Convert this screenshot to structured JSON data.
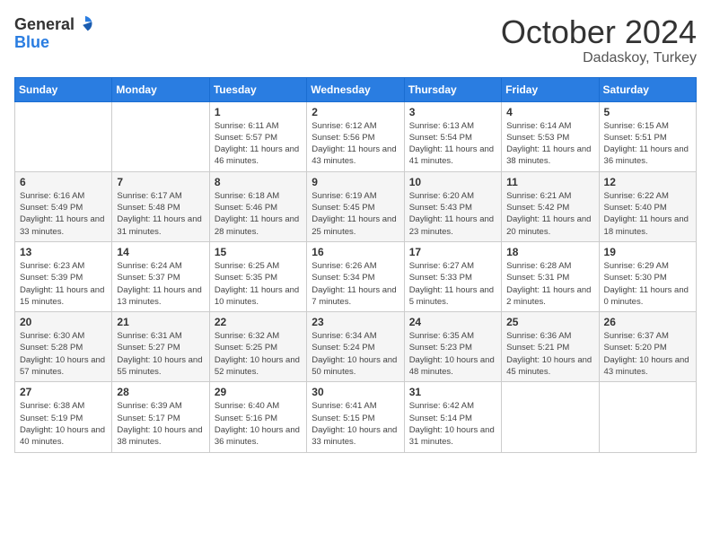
{
  "header": {
    "logo": {
      "general": "General",
      "blue": "Blue"
    },
    "month": "October 2024",
    "location": "Dadaskoy, Turkey"
  },
  "days_of_week": [
    "Sunday",
    "Monday",
    "Tuesday",
    "Wednesday",
    "Thursday",
    "Friday",
    "Saturday"
  ],
  "weeks": [
    [
      {
        "day": null,
        "info": null
      },
      {
        "day": null,
        "info": null
      },
      {
        "day": "1",
        "sunrise": "6:11 AM",
        "sunset": "5:57 PM",
        "daylight": "11 hours and 46 minutes."
      },
      {
        "day": "2",
        "sunrise": "6:12 AM",
        "sunset": "5:56 PM",
        "daylight": "11 hours and 43 minutes."
      },
      {
        "day": "3",
        "sunrise": "6:13 AM",
        "sunset": "5:54 PM",
        "daylight": "11 hours and 41 minutes."
      },
      {
        "day": "4",
        "sunrise": "6:14 AM",
        "sunset": "5:53 PM",
        "daylight": "11 hours and 38 minutes."
      },
      {
        "day": "5",
        "sunrise": "6:15 AM",
        "sunset": "5:51 PM",
        "daylight": "11 hours and 36 minutes."
      }
    ],
    [
      {
        "day": "6",
        "sunrise": "6:16 AM",
        "sunset": "5:49 PM",
        "daylight": "11 hours and 33 minutes."
      },
      {
        "day": "7",
        "sunrise": "6:17 AM",
        "sunset": "5:48 PM",
        "daylight": "11 hours and 31 minutes."
      },
      {
        "day": "8",
        "sunrise": "6:18 AM",
        "sunset": "5:46 PM",
        "daylight": "11 hours and 28 minutes."
      },
      {
        "day": "9",
        "sunrise": "6:19 AM",
        "sunset": "5:45 PM",
        "daylight": "11 hours and 25 minutes."
      },
      {
        "day": "10",
        "sunrise": "6:20 AM",
        "sunset": "5:43 PM",
        "daylight": "11 hours and 23 minutes."
      },
      {
        "day": "11",
        "sunrise": "6:21 AM",
        "sunset": "5:42 PM",
        "daylight": "11 hours and 20 minutes."
      },
      {
        "day": "12",
        "sunrise": "6:22 AM",
        "sunset": "5:40 PM",
        "daylight": "11 hours and 18 minutes."
      }
    ],
    [
      {
        "day": "13",
        "sunrise": "6:23 AM",
        "sunset": "5:39 PM",
        "daylight": "11 hours and 15 minutes."
      },
      {
        "day": "14",
        "sunrise": "6:24 AM",
        "sunset": "5:37 PM",
        "daylight": "11 hours and 13 minutes."
      },
      {
        "day": "15",
        "sunrise": "6:25 AM",
        "sunset": "5:35 PM",
        "daylight": "11 hours and 10 minutes."
      },
      {
        "day": "16",
        "sunrise": "6:26 AM",
        "sunset": "5:34 PM",
        "daylight": "11 hours and 7 minutes."
      },
      {
        "day": "17",
        "sunrise": "6:27 AM",
        "sunset": "5:33 PM",
        "daylight": "11 hours and 5 minutes."
      },
      {
        "day": "18",
        "sunrise": "6:28 AM",
        "sunset": "5:31 PM",
        "daylight": "11 hours and 2 minutes."
      },
      {
        "day": "19",
        "sunrise": "6:29 AM",
        "sunset": "5:30 PM",
        "daylight": "11 hours and 0 minutes."
      }
    ],
    [
      {
        "day": "20",
        "sunrise": "6:30 AM",
        "sunset": "5:28 PM",
        "daylight": "10 hours and 57 minutes."
      },
      {
        "day": "21",
        "sunrise": "6:31 AM",
        "sunset": "5:27 PM",
        "daylight": "10 hours and 55 minutes."
      },
      {
        "day": "22",
        "sunrise": "6:32 AM",
        "sunset": "5:25 PM",
        "daylight": "10 hours and 52 minutes."
      },
      {
        "day": "23",
        "sunrise": "6:34 AM",
        "sunset": "5:24 PM",
        "daylight": "10 hours and 50 minutes."
      },
      {
        "day": "24",
        "sunrise": "6:35 AM",
        "sunset": "5:23 PM",
        "daylight": "10 hours and 48 minutes."
      },
      {
        "day": "25",
        "sunrise": "6:36 AM",
        "sunset": "5:21 PM",
        "daylight": "10 hours and 45 minutes."
      },
      {
        "day": "26",
        "sunrise": "6:37 AM",
        "sunset": "5:20 PM",
        "daylight": "10 hours and 43 minutes."
      }
    ],
    [
      {
        "day": "27",
        "sunrise": "6:38 AM",
        "sunset": "5:19 PM",
        "daylight": "10 hours and 40 minutes."
      },
      {
        "day": "28",
        "sunrise": "6:39 AM",
        "sunset": "5:17 PM",
        "daylight": "10 hours and 38 minutes."
      },
      {
        "day": "29",
        "sunrise": "6:40 AM",
        "sunset": "5:16 PM",
        "daylight": "10 hours and 36 minutes."
      },
      {
        "day": "30",
        "sunrise": "6:41 AM",
        "sunset": "5:15 PM",
        "daylight": "10 hours and 33 minutes."
      },
      {
        "day": "31",
        "sunrise": "6:42 AM",
        "sunset": "5:14 PM",
        "daylight": "10 hours and 31 minutes."
      },
      {
        "day": null,
        "info": null
      },
      {
        "day": null,
        "info": null
      }
    ]
  ],
  "labels": {
    "sunrise": "Sunrise:",
    "sunset": "Sunset:",
    "daylight": "Daylight:"
  }
}
